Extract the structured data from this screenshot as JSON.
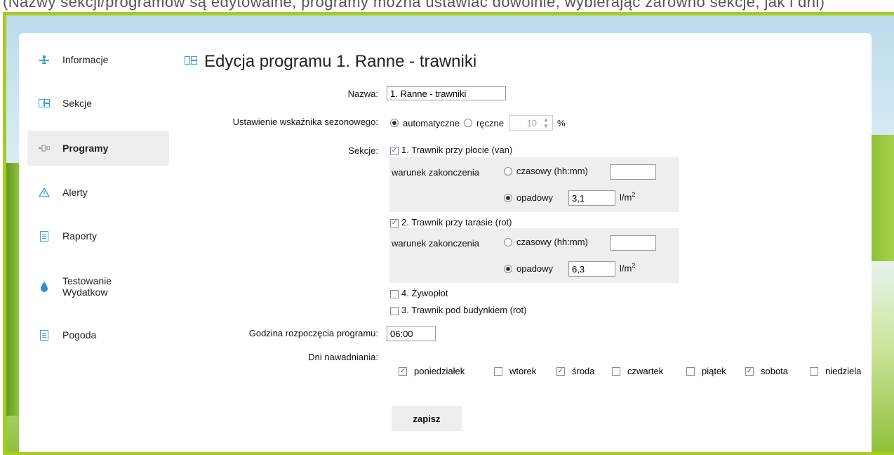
{
  "top_caption": "(Nazwy sekcji/programów są edytowalne, programy można ustawiać dowolnie, wybierając zarówno sekcje, jak i dni)",
  "sidebar": {
    "items": [
      {
        "label": "Informacje",
        "icon": "network-icon"
      },
      {
        "label": "Sekcje",
        "icon": "sections-icon"
      },
      {
        "label": "Programy",
        "icon": "program-icon",
        "active": true
      },
      {
        "label": "Alerty",
        "icon": "warning-icon"
      },
      {
        "label": "Raporty",
        "icon": "report-icon"
      },
      {
        "label": "Testowanie Wydatkow",
        "icon": "water-drop-icon"
      },
      {
        "label": "Pogoda",
        "icon": "weather-doc-icon"
      }
    ]
  },
  "page": {
    "title": "Edycja programu 1. Ranne - trawniki"
  },
  "form": {
    "name_label": "Nazwa:",
    "name_value": "1. Ranne - trawniki",
    "seasonal_label": "Ustawienie wskaźnika sezonowego:",
    "seasonal_auto": "automatyczne",
    "seasonal_manual": "ręczne",
    "seasonal_value": "10",
    "percent": "%",
    "sections_label": "Sekcje:",
    "sections": [
      {
        "name": "1. Trawnik przy płocie (van)",
        "checked": true,
        "end_label": "warunek zakonczenia",
        "time_label": "czasowy (hh:mm)",
        "time_value": "",
        "rain_label": "opadowy",
        "rain_value": "3,1",
        "unit": "l/m",
        "unit_sup": "2"
      },
      {
        "name": "2. Trawnik przy tarasie (rot)",
        "checked": true,
        "end_label": "warunek zakonczenia",
        "time_label": "czasowy (hh:mm)",
        "time_value": "",
        "rain_label": "opadowy",
        "rain_value": "6,3",
        "unit": "l/m",
        "unit_sup": "2"
      },
      {
        "name": "4. Żywopłot",
        "checked": false
      },
      {
        "name": "3. Trawnik pod budynkiem (rot)",
        "checked": false
      }
    ],
    "start_label": "Godzina rozpoczęcia programu:",
    "start_value": "06:00",
    "days_label": "Dni nawadniania:",
    "days": [
      {
        "name": "poniedziałek",
        "checked": true
      },
      {
        "name": "wtorek",
        "checked": false
      },
      {
        "name": "środa",
        "checked": true
      },
      {
        "name": "czwartek",
        "checked": false
      },
      {
        "name": "piątek",
        "checked": false
      },
      {
        "name": "sobota",
        "checked": true
      },
      {
        "name": "niedziela",
        "checked": false
      }
    ],
    "save_label": "zapisz"
  }
}
